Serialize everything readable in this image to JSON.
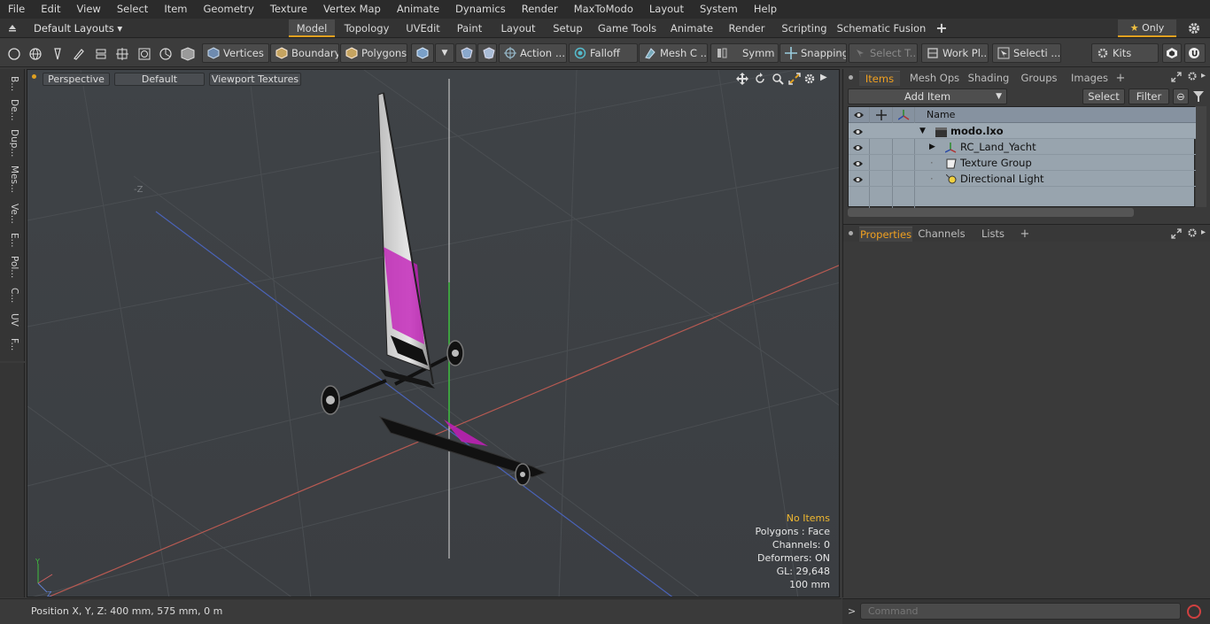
{
  "menu": [
    "File",
    "Edit",
    "View",
    "Select",
    "Item",
    "Geometry",
    "Texture",
    "Vertex Map",
    "Animate",
    "Dynamics",
    "Render",
    "MaxToModo",
    "Layout",
    "System",
    "Help"
  ],
  "layout_selector": "Default Layouts",
  "layout_tabs": [
    "Model",
    "Topology",
    "UVEdit",
    "Paint",
    "Layout",
    "Setup",
    "Game Tools",
    "Animate",
    "Render",
    "Scripting",
    "Schematic Fusion"
  ],
  "active_layout_tab": "Model",
  "only_label": "Only",
  "toolbar": {
    "vertices": "Vertices",
    "boundary": "Boundary",
    "polygons": "Polygons",
    "action": "Action",
    "falloff": "Falloff",
    "mesh_c": "Mesh C ...",
    "symm": "Symm ...",
    "snapping": "Snapping",
    "select_t": "Select T...",
    "work_pl": "Work Pl...",
    "selecti": "Selecti ...",
    "kits": "Kits"
  },
  "left_tabs": [
    "B...",
    "De...",
    "Dup...",
    "Mes...",
    "Ve...",
    "E...",
    "Pol...",
    "C...",
    "UV",
    "F..."
  ],
  "viewport": {
    "view_mode": "Perspective",
    "shading": "Default",
    "textures": "Viewport Textures",
    "axis_label": "-Z",
    "info": {
      "selection": "No Items",
      "polygons": "Polygons : Face",
      "channels": "Channels: 0",
      "deformers": "Deformers: ON",
      "gl": "GL: 29,648",
      "grid": "100 mm"
    }
  },
  "status": "Position X, Y, Z:   400 mm, 575 mm, 0 m",
  "items_panel": {
    "tabs": [
      "Items",
      "Mesh Ops",
      "Shading",
      "Groups",
      "Images"
    ],
    "active_tab": "Items",
    "add_item": "Add Item",
    "select": "Select",
    "filter": "Filter",
    "column_name": "Name",
    "rows": [
      {
        "label": "modo.lxo",
        "bold": true
      },
      {
        "label": "RC_Land_Yacht",
        "bold": false
      },
      {
        "label": "Texture Group",
        "bold": false
      },
      {
        "label": "Directional Light",
        "bold": false
      }
    ]
  },
  "props_panel": {
    "tabs": [
      "Properties",
      "Channels",
      "Lists"
    ],
    "active_tab": "Properties"
  },
  "command_placeholder": "Command",
  "colors": {
    "accent": "#e0a020",
    "item_bg": "#98a4ae",
    "sail_magenta": "#c21fb8"
  }
}
